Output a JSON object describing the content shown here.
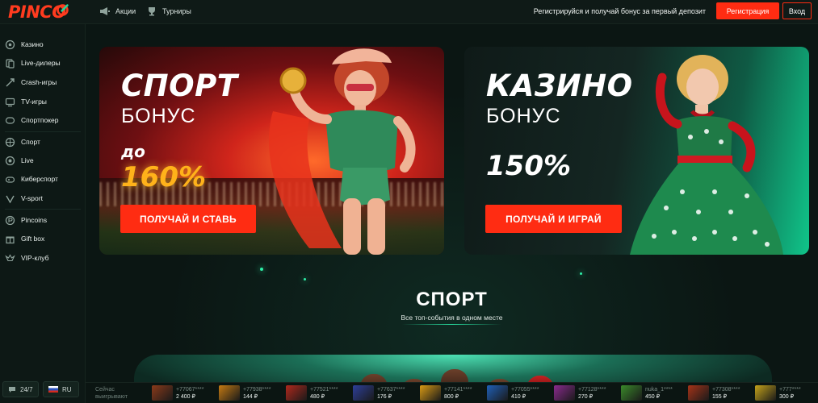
{
  "brand": {
    "logo_text": "PINCO"
  },
  "header": {
    "promo_label": "Акции",
    "tournaments_label": "Турниры",
    "register_prompt": "Регистрируйся и получай бонус за первый депозит",
    "register_button": "Регистрация",
    "login_button": "Вход"
  },
  "sidebar": {
    "items": [
      {
        "label": "Казино",
        "icon": "casino-icon"
      },
      {
        "label": "Live-дилеры",
        "icon": "live-dealers-icon"
      },
      {
        "label": "Crash-игры",
        "icon": "crash-icon"
      },
      {
        "label": "TV-игры",
        "icon": "tv-icon"
      },
      {
        "label": "Спортпокер",
        "icon": "sportpoker-icon"
      },
      {
        "label": "Спорт",
        "icon": "sport-icon"
      },
      {
        "label": "Live",
        "icon": "live-icon"
      },
      {
        "label": "Киберспорт",
        "icon": "esports-icon"
      },
      {
        "label": "V-sport",
        "icon": "vsport-icon"
      },
      {
        "label": "Pincoins",
        "icon": "pincoins-icon"
      },
      {
        "label": "Gift box",
        "icon": "gift-icon"
      },
      {
        "label": "VIP-клуб",
        "icon": "vip-icon"
      }
    ],
    "support_label": "24/7",
    "language_label": "RU"
  },
  "banners": {
    "sport": {
      "title": "СПОРТ",
      "subtitle": "БОНУС",
      "prefix": "до",
      "percent": "160%",
      "button": "ПОЛУЧАЙ И СТАВЬ"
    },
    "casino": {
      "title": "КАЗИНО",
      "subtitle": "БОНУС",
      "percent": "150%",
      "button": "ПОЛУЧАЙ И ИГРАЙ"
    }
  },
  "section": {
    "title": "СПОРТ",
    "subtitle": "Все топ-события в одном месте"
  },
  "ticker": {
    "label_line1": "Сейчас",
    "label_line2": "выигрывают",
    "wins": [
      {
        "user": "+77067****",
        "amount": "2 400 ₽",
        "color": "#8b3a1a"
      },
      {
        "user": "+77938****",
        "amount": "144 ₽",
        "color": "#c47a12"
      },
      {
        "user": "+77521****",
        "amount": "480 ₽",
        "color": "#b0281c"
      },
      {
        "user": "+77637****",
        "amount": "176 ₽",
        "color": "#2d3f9a"
      },
      {
        "user": "+77141****",
        "amount": "800 ₽",
        "color": "#d99a14"
      },
      {
        "user": "+77055****",
        "amount": "410 ₽",
        "color": "#1f5fb8"
      },
      {
        "user": "+77128****",
        "amount": "270 ₽",
        "color": "#8a2b8e"
      },
      {
        "user": "nuka_1****",
        "amount": "450 ₽",
        "color": "#3a8a2a"
      },
      {
        "user": "+77308****",
        "amount": "155 ₽",
        "color": "#a53318"
      },
      {
        "user": "+777****",
        "amount": "300 ₽",
        "color": "#c4a21a"
      }
    ]
  },
  "colors": {
    "accent": "#ff2c12",
    "green": "#27d69a",
    "background": "#0c1714"
  }
}
